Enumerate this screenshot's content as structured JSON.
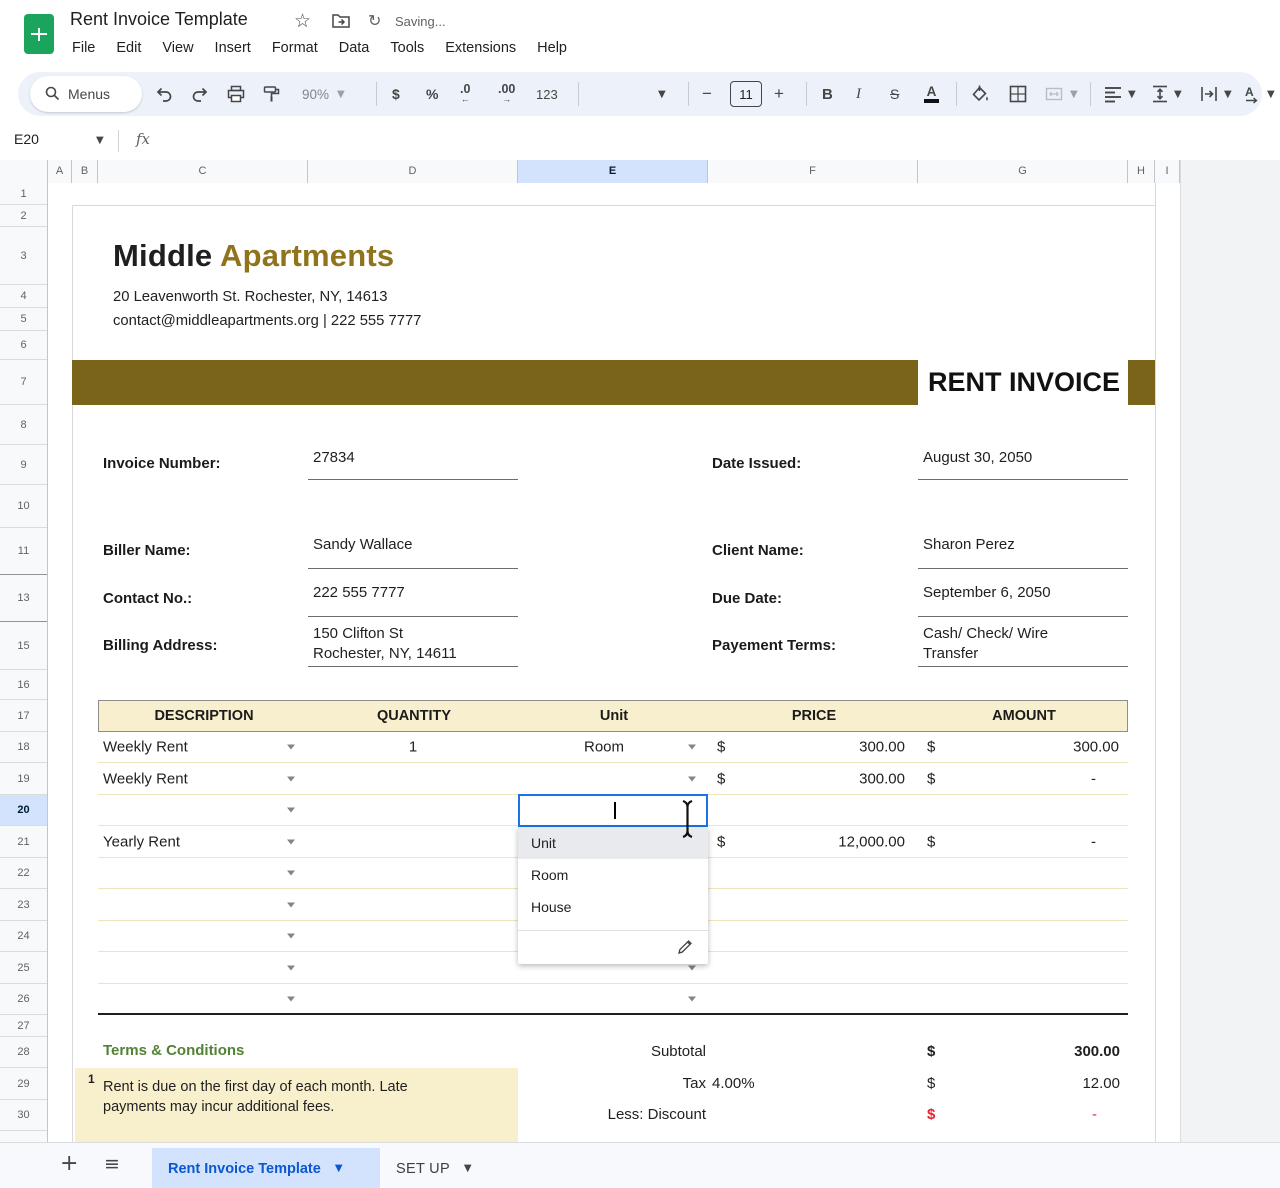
{
  "app": {
    "title": "Rent Invoice Template",
    "saving_status": "Saving...",
    "menus": [
      "File",
      "Edit",
      "View",
      "Insert",
      "Format",
      "Data",
      "Tools",
      "Extensions",
      "Help"
    ]
  },
  "toolbar": {
    "menus_label": "Menus",
    "zoom_level": "90%",
    "currency": "$",
    "percent": "%",
    "decimal_decrease": ".0",
    "decimal_increase": ".00",
    "number_format": "123",
    "font_size": "11",
    "bold": "B",
    "italic": "I",
    "strikethrough": "S",
    "text_color": "A"
  },
  "formula_bar": {
    "cell_reference": "E20",
    "fx_label": "fx"
  },
  "grid": {
    "columns": [
      "A",
      "B",
      "C",
      "D",
      "E",
      "F",
      "G",
      "H",
      "I"
    ],
    "rows": [
      "1",
      "2",
      "3",
      "4",
      "5",
      "6",
      "7",
      "8",
      "9",
      "10",
      "11",
      "13",
      "15",
      "16",
      "17",
      "18",
      "19",
      "20",
      "21",
      "22",
      "23",
      "24",
      "25",
      "26",
      "27",
      "28",
      "29",
      "30"
    ],
    "selected_column": "E",
    "selected_row": "20"
  },
  "invoice": {
    "company": {
      "name_primary": "Middle",
      "name_secondary": "Apartments",
      "address": "20 Leavenworth St. Rochester, NY, 14613",
      "contact": "contact@middleapartments.org | 222 555 7777"
    },
    "banner_title": "RENT INVOICE",
    "fields": {
      "invoice_number": {
        "label": "Invoice Number:",
        "value": "27834"
      },
      "date_issued": {
        "label": "Date Issued:",
        "value": "August 30, 2050"
      },
      "biller_name": {
        "label": "Biller Name:",
        "value": "Sandy Wallace"
      },
      "client_name": {
        "label": "Client Name:",
        "value": "Sharon Perez"
      },
      "contact_no": {
        "label": "Contact No.:",
        "value": "222 555 7777"
      },
      "due_date": {
        "label": "Due Date:",
        "value": "September 6, 2050"
      },
      "billing_address": {
        "label": "Billing Address:",
        "value_line1": "150 Clifton St",
        "value_line2": "Rochester, NY, 14611"
      },
      "payment_terms": {
        "label": "Payement Terms:",
        "value_line1": "Cash/ Check/ Wire",
        "value_line2": "Transfer"
      }
    },
    "table": {
      "headers": [
        "DESCRIPTION",
        "QUANTITY",
        "Unit",
        "PRICE",
        "AMOUNT"
      ],
      "rows": [
        {
          "description": "Weekly Rent",
          "quantity": "1",
          "unit": "Room",
          "price_currency": "$",
          "price": "300.00",
          "amount_currency": "$",
          "amount": "300.00"
        },
        {
          "description": "Weekly Rent",
          "quantity": "",
          "unit": "",
          "price_currency": "$",
          "price": "300.00",
          "amount_currency": "$",
          "amount": "-"
        },
        {
          "description": "",
          "quantity": "",
          "unit": "",
          "price_currency": "",
          "price": "",
          "amount_currency": "",
          "amount": ""
        },
        {
          "description": "Yearly Rent",
          "quantity": "",
          "unit": "",
          "price_currency": "$",
          "price": "12,000.00",
          "amount_currency": "$",
          "amount": "-"
        },
        {
          "description": "",
          "quantity": "",
          "unit": "",
          "price_currency": "",
          "price": "",
          "amount_currency": "",
          "amount": ""
        },
        {
          "description": "",
          "quantity": "",
          "unit": "",
          "price_currency": "",
          "price": "",
          "amount_currency": "",
          "amount": ""
        },
        {
          "description": "",
          "quantity": "",
          "unit": "",
          "price_currency": "",
          "price": "",
          "amount_currency": "",
          "amount": ""
        },
        {
          "description": "",
          "quantity": "",
          "unit": "",
          "price_currency": "",
          "price": "",
          "amount_currency": "",
          "amount": ""
        },
        {
          "description": "",
          "quantity": "",
          "unit": "",
          "price_currency": "",
          "price": "",
          "amount_currency": "",
          "amount": ""
        }
      ]
    },
    "totals": {
      "subtotal": {
        "label": "Subtotal",
        "currency": "$",
        "value": "300.00"
      },
      "tax": {
        "label": "Tax",
        "rate": "4.00%",
        "currency": "$",
        "value": "12.00"
      },
      "discount": {
        "label": "Less: Discount",
        "currency": "$",
        "value": "-"
      }
    },
    "terms": {
      "heading": "Terms & Conditions",
      "note_index": "1",
      "note": "Rent is due on the first day of each month. Late payments may incur additional fees."
    }
  },
  "dropdown": {
    "options": [
      "Unit",
      "Room",
      "House"
    ],
    "highlighted_option": "Unit"
  },
  "sheet_tabs": {
    "active": "Rent Invoice Template",
    "secondary": "SET UP"
  },
  "colors": {
    "accent_blue": "#1a73e8",
    "gold_banner": "#79641a",
    "gold_text": "#8f741c",
    "cream": "#f7efcd",
    "green_heading": "#538135",
    "red": "#e8222e",
    "active_tab_bg": "#d3e3fd",
    "active_tab_text": "#0b57d0"
  }
}
